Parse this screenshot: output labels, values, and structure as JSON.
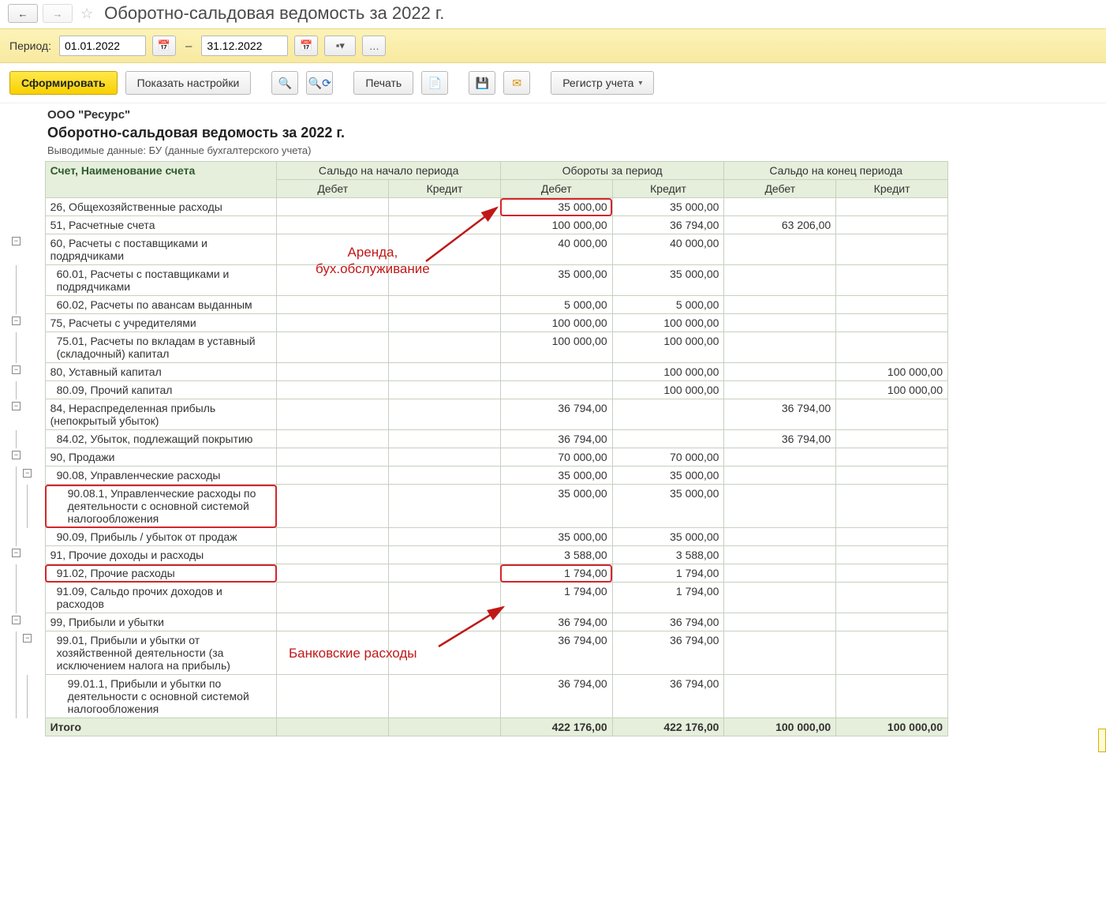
{
  "nav": {
    "title": "Оборотно-сальдовая ведомость за 2022 г."
  },
  "period": {
    "label": "Период:",
    "from": "01.01.2022",
    "to": "31.12.2022",
    "dash": "–"
  },
  "toolbar": {
    "generate": "Сформировать",
    "settings": "Показать настройки",
    "print": "Печать",
    "register": "Регистр учета"
  },
  "report": {
    "org": "ООО \"Ресурс\"",
    "title": "Оборотно-сальдовая ведомость за 2022 г.",
    "subtitle": "Выводимые данные: БУ (данные бухгалтерского учета)"
  },
  "columns": {
    "account": "Счет, Наименование счета",
    "open": "Сальдо на начало периода",
    "turn": "Обороты за период",
    "close": "Сальдо на конец периода",
    "debit": "Дебет",
    "credit": "Кредит"
  },
  "rows": [
    {
      "lvl": 0,
      "exp": false,
      "name": "26, Общехозяйственные расходы",
      "od": "",
      "oc": "",
      "td": "35 000,00",
      "tc": "35 000,00",
      "cd": "",
      "cc": "",
      "hl_td": true
    },
    {
      "lvl": 0,
      "exp": false,
      "name": "51, Расчетные счета",
      "od": "",
      "oc": "",
      "td": "100 000,00",
      "tc": "36 794,00",
      "cd": "63 206,00",
      "cc": ""
    },
    {
      "lvl": 0,
      "exp": true,
      "name": "60, Расчеты с поставщиками и подрядчиками",
      "od": "",
      "oc": "",
      "td": "40 000,00",
      "tc": "40 000,00",
      "cd": "",
      "cc": ""
    },
    {
      "lvl": 1,
      "exp": false,
      "name": "60.01, Расчеты с поставщиками и подрядчиками",
      "od": "",
      "oc": "",
      "td": "35 000,00",
      "tc": "35 000,00",
      "cd": "",
      "cc": ""
    },
    {
      "lvl": 1,
      "exp": false,
      "name": "60.02, Расчеты по авансам выданным",
      "od": "",
      "oc": "",
      "td": "5 000,00",
      "tc": "5 000,00",
      "cd": "",
      "cc": ""
    },
    {
      "lvl": 0,
      "exp": true,
      "name": "75, Расчеты с учредителями",
      "od": "",
      "oc": "",
      "td": "100 000,00",
      "tc": "100 000,00",
      "cd": "",
      "cc": ""
    },
    {
      "lvl": 1,
      "exp": false,
      "name": "75.01, Расчеты по вкладам в уставный (складочный) капитал",
      "od": "",
      "oc": "",
      "td": "100 000,00",
      "tc": "100 000,00",
      "cd": "",
      "cc": ""
    },
    {
      "lvl": 0,
      "exp": true,
      "name": "80, Уставный капитал",
      "od": "",
      "oc": "",
      "td": "",
      "tc": "100 000,00",
      "cd": "",
      "cc": "100 000,00"
    },
    {
      "lvl": 1,
      "exp": false,
      "name": "80.09, Прочий капитал",
      "od": "",
      "oc": "",
      "td": "",
      "tc": "100 000,00",
      "cd": "",
      "cc": "100 000,00"
    },
    {
      "lvl": 0,
      "exp": true,
      "name": "84, Нераспределенная прибыль (непокрытый убыток)",
      "od": "",
      "oc": "",
      "td": "36 794,00",
      "tc": "",
      "cd": "36 794,00",
      "cc": ""
    },
    {
      "lvl": 1,
      "exp": false,
      "name": "84.02, Убыток, подлежащий покрытию",
      "od": "",
      "oc": "",
      "td": "36 794,00",
      "tc": "",
      "cd": "36 794,00",
      "cc": ""
    },
    {
      "lvl": 0,
      "exp": true,
      "name": "90, Продажи",
      "od": "",
      "oc": "",
      "td": "70 000,00",
      "tc": "70 000,00",
      "cd": "",
      "cc": ""
    },
    {
      "lvl": 1,
      "exp": true,
      "name": "90.08, Управленческие расходы",
      "od": "",
      "oc": "",
      "td": "35 000,00",
      "tc": "35 000,00",
      "cd": "",
      "cc": ""
    },
    {
      "lvl": 2,
      "exp": false,
      "name": "90.08.1, Управленческие расходы по деятельности с основной системой налогообложения",
      "od": "",
      "oc": "",
      "td": "35 000,00",
      "tc": "35 000,00",
      "cd": "",
      "cc": "",
      "hl_name": true
    },
    {
      "lvl": 1,
      "exp": false,
      "name": "90.09, Прибыль / убыток от продаж",
      "od": "",
      "oc": "",
      "td": "35 000,00",
      "tc": "35 000,00",
      "cd": "",
      "cc": ""
    },
    {
      "lvl": 0,
      "exp": true,
      "name": "91, Прочие доходы и расходы",
      "od": "",
      "oc": "",
      "td": "3 588,00",
      "tc": "3 588,00",
      "cd": "",
      "cc": ""
    },
    {
      "lvl": 1,
      "exp": false,
      "name": "91.02, Прочие расходы",
      "od": "",
      "oc": "",
      "td": "1 794,00",
      "tc": "1 794,00",
      "cd": "",
      "cc": "",
      "hl_name": true,
      "hl_td": true
    },
    {
      "lvl": 1,
      "exp": false,
      "name": "91.09, Сальдо прочих доходов и расходов",
      "od": "",
      "oc": "",
      "td": "1 794,00",
      "tc": "1 794,00",
      "cd": "",
      "cc": ""
    },
    {
      "lvl": 0,
      "exp": true,
      "name": "99, Прибыли и убытки",
      "od": "",
      "oc": "",
      "td": "36 794,00",
      "tc": "36 794,00",
      "cd": "",
      "cc": ""
    },
    {
      "lvl": 1,
      "exp": true,
      "name": "99.01, Прибыли и убытки от хозяйственной деятельности (за исключением налога на прибыль)",
      "od": "",
      "oc": "",
      "td": "36 794,00",
      "tc": "36 794,00",
      "cd": "",
      "cc": ""
    },
    {
      "lvl": 2,
      "exp": false,
      "name": "99.01.1, Прибыли и убытки по деятельности с основной системой налогообложения",
      "od": "",
      "oc": "",
      "td": "36 794,00",
      "tc": "36 794,00",
      "cd": "",
      "cc": ""
    }
  ],
  "total": {
    "label": "Итого",
    "od": "",
    "oc": "",
    "td": "422 176,00",
    "tc": "422 176,00",
    "cd": "100 000,00",
    "cc": "100 000,00"
  },
  "annotations": {
    "a1_l1": "Аренда,",
    "a1_l2": "бух.обслуживание",
    "a2": "Банковские расходы"
  }
}
